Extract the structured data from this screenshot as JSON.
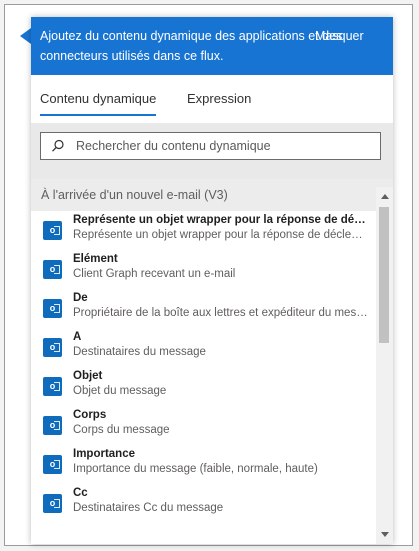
{
  "header": {
    "text": "Ajoutez du contenu dynamique des applications et des connecteurs utilisés dans ce flux.",
    "hide_label": "Masquer"
  },
  "tabs": [
    {
      "label": "Contenu dynamique",
      "active": true
    },
    {
      "label": "Expression",
      "active": false
    }
  ],
  "search": {
    "placeholder": "Rechercher du contenu dynamique"
  },
  "section_title": "À l'arrivée d'un nouvel e-mail (V3)",
  "items": [
    {
      "title": "Représente un objet wrapper pour la réponse de déclen...",
      "sub": "Représente un objet wrapper pour la réponse de déclenc...",
      "icon": "outlook-icon"
    },
    {
      "title": "Élément",
      "sub": "Client Graph recevant un e-mail",
      "icon": "outlook-icon"
    },
    {
      "title": "De",
      "sub": "Propriétaire de la boîte aux lettres et expéditeur du mess...",
      "icon": "outlook-icon"
    },
    {
      "title": "À",
      "sub": "Destinataires du message",
      "icon": "outlook-icon"
    },
    {
      "title": "Objet",
      "sub": "Objet du message",
      "icon": "outlook-icon"
    },
    {
      "title": "Corps",
      "sub": "Corps du message",
      "icon": "outlook-icon"
    },
    {
      "title": "Importance",
      "sub": "Importance du message (faible, normale, haute)",
      "icon": "outlook-icon"
    },
    {
      "title": "Cc",
      "sub": "Destinataires Cc du message",
      "icon": "outlook-icon"
    }
  ],
  "colors": {
    "accent": "#1874d2",
    "icon_bg": "#0f6cbd"
  }
}
